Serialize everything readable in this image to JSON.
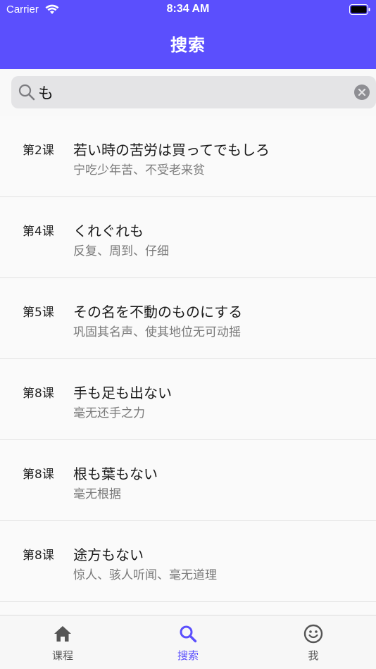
{
  "status_bar": {
    "carrier": "Carrier",
    "time": "8:34 AM"
  },
  "header": {
    "title": "搜索"
  },
  "search": {
    "value": "も"
  },
  "results": [
    {
      "lesson": "第2课",
      "phrase": "若い時の苦労は買ってでもしろ",
      "meaning": "宁吃少年苦、不受老来贫"
    },
    {
      "lesson": "第4课",
      "phrase": "くれぐれも",
      "meaning": "反复、周到、仔细"
    },
    {
      "lesson": "第5课",
      "phrase": "その名を不動のものにする",
      "meaning": "巩固其名声、使其地位无可动摇"
    },
    {
      "lesson": "第8课",
      "phrase": "手も足も出ない",
      "meaning": "毫无还手之力"
    },
    {
      "lesson": "第8课",
      "phrase": "根も葉もない",
      "meaning": "毫无根据"
    },
    {
      "lesson": "第8课",
      "phrase": "途方もない",
      "meaning": "惊人、骇人听闻、毫无道理"
    }
  ],
  "tabs": [
    {
      "label": "课程",
      "icon": "home-icon"
    },
    {
      "label": "搜索",
      "icon": "search-icon"
    },
    {
      "label": "我",
      "icon": "smiley-icon"
    }
  ],
  "colors": {
    "accent": "#5b4ffd",
    "inactive": "#555555"
  }
}
